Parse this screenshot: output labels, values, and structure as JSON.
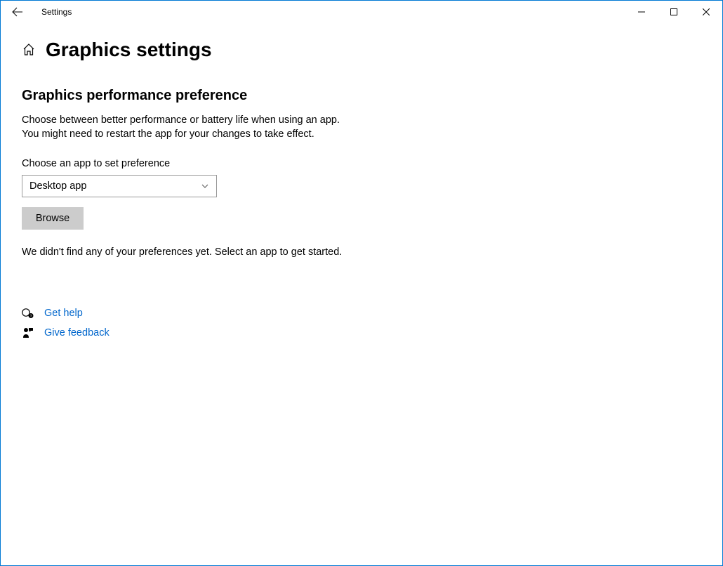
{
  "titlebar": {
    "app_title": "Settings"
  },
  "page": {
    "title": "Graphics settings"
  },
  "section": {
    "title": "Graphics performance preference",
    "description_line1": "Choose between better performance or battery life when using an app.",
    "description_line2": "You might need to restart the app for your changes to take effect.",
    "field_label": "Choose an app to set preference",
    "dropdown_value": "Desktop app",
    "browse_label": "Browse",
    "empty_text": "We didn't find any of your preferences yet. Select an app to get started."
  },
  "links": {
    "help": "Get help",
    "feedback": "Give feedback"
  }
}
